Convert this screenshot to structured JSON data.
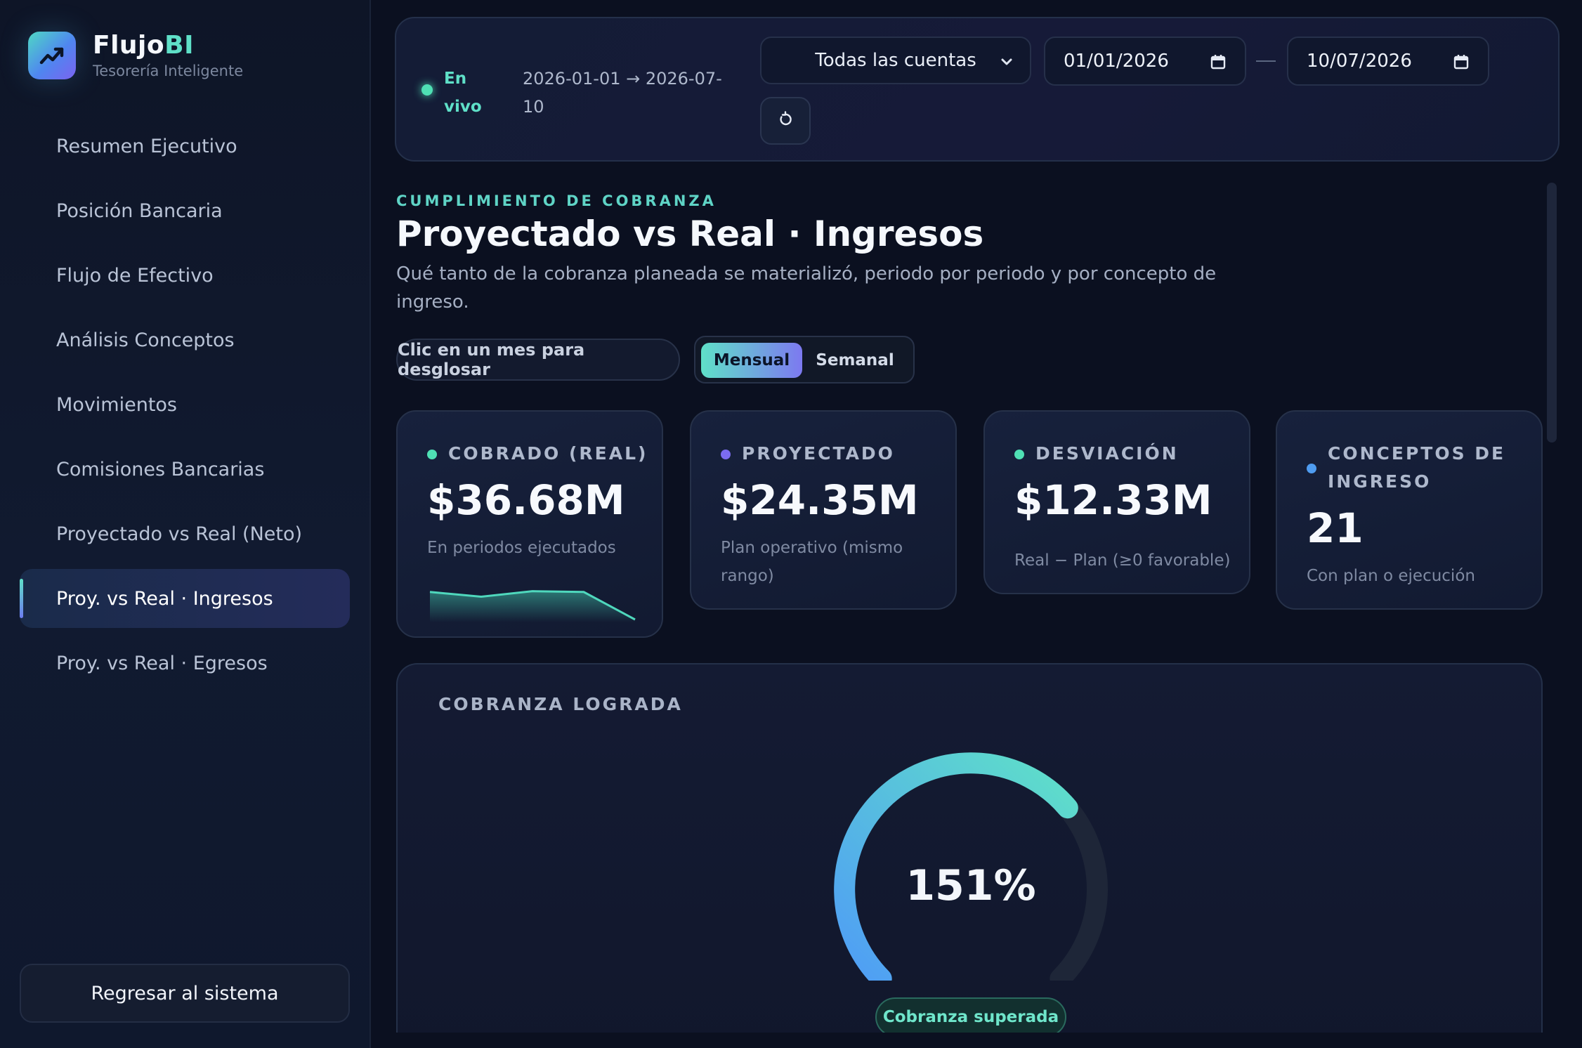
{
  "brand": {
    "name_main": "Flujo",
    "name_accent": "BI",
    "subtitle": "Tesorería Inteligente"
  },
  "sidebar": {
    "items": [
      {
        "label": "Resumen Ejecutivo",
        "active": false
      },
      {
        "label": "Posición Bancaria",
        "active": false
      },
      {
        "label": "Flujo de Efectivo",
        "active": false
      },
      {
        "label": "Análisis Conceptos",
        "active": false
      },
      {
        "label": "Movimientos",
        "active": false
      },
      {
        "label": "Comisiones Bancarias",
        "active": false
      },
      {
        "label": "Proyectado vs Real (Neto)",
        "active": false
      },
      {
        "label": "Proy. vs Real · Ingresos",
        "active": true
      },
      {
        "label": "Proy. vs Real · Egresos",
        "active": false
      }
    ],
    "back_button": "Regresar al sistema"
  },
  "topbar": {
    "live_label": "En vivo",
    "range_text": "2026-01-01 → 2026-07-10",
    "account_select": "Todas las cuentas",
    "date_from": "01/01/2026",
    "date_to": "10/07/2026"
  },
  "header": {
    "eyebrow": "CUMPLIMIENTO DE COBRANZA",
    "title": "Proyectado vs Real · Ingresos",
    "description": "Qué tanto de la cobranza planeada se materializó, periodo por periodo y por concepto de ingreso."
  },
  "controls": {
    "hint": "Clic en un mes para desglosar",
    "view_monthly": "Mensual",
    "view_weekly": "Semanal",
    "selected_view": "Mensual"
  },
  "kpis": [
    {
      "label": "COBRADO (REAL)",
      "value": "$36.68M",
      "note": "En periodos ejecutados",
      "dot_color": "#4fe0b4",
      "sparkline": [
        0.7,
        0.58,
        0.72,
        0.7,
        0.0
      ]
    },
    {
      "label": "PROYECTADO",
      "value": "$24.35M",
      "note": "Plan operativo (mismo rango)",
      "dot_color": "#7b6cf0"
    },
    {
      "label": "DESVIACIÓN",
      "value": "$12.33M",
      "note": "Real − Plan (≥0 favorable)",
      "dot_color": "#4fe0b4"
    },
    {
      "label": "CONCEPTOS DE INGRESO",
      "value": "21",
      "note": "Con plan o ejecución",
      "dot_color": "#4f9cf0"
    }
  ],
  "gauge": {
    "title": "COBRANZA LOGRADA",
    "value_text": "151%",
    "value_percent": 151,
    "badge": "Cobranza superada",
    "colors": {
      "start": "#4f9cf6",
      "end": "#5fe0c8",
      "track": "#1e2638"
    }
  },
  "icons": {
    "logo": "trend-up-icon",
    "select": "chevron-down-icon",
    "date": "calendar-icon",
    "refresh": "refresh-icon"
  }
}
